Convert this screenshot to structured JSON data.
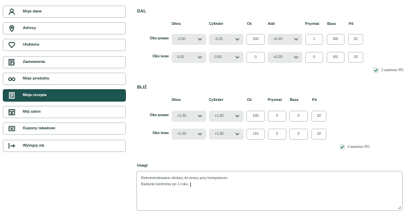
{
  "sidebar": {
    "items": [
      {
        "label": "Moje dane",
        "icon": "user-icon",
        "active": false
      },
      {
        "label": "Adresy",
        "icon": "location-pin-icon",
        "active": false
      },
      {
        "label": "Ulubione",
        "icon": "heart-icon",
        "active": false
      },
      {
        "label": "Zamówienia",
        "icon": "order-list-icon",
        "active": false
      },
      {
        "label": "Moje produkty",
        "icon": "glasses-icon",
        "active": false
      },
      {
        "label": "Moja recepta",
        "icon": "prescription-icon",
        "active": true
      },
      {
        "label": "Mój salon",
        "icon": "store-icon",
        "active": false
      },
      {
        "label": "Kupony rabatowe",
        "icon": "coupon-icon",
        "active": false
      },
      {
        "label": "Wyloguj się",
        "icon": "logout-icon",
        "active": false
      }
    ]
  },
  "dal": {
    "title": "DAL",
    "headers": {
      "sfera": "Sfera",
      "cylinder": "Cylinder",
      "os": "Oś",
      "add": "Add",
      "pryzmat": "Pryzmat",
      "baza": "Baza",
      "pd": "Pd"
    },
    "rows": [
      {
        "label": "Oko prawe",
        "sfera": "-2.50",
        "cylinder": "-0.25",
        "os": "180",
        "add": "+0.25",
        "pryzmat": "1",
        "baza": "BN",
        "pd": "32"
      },
      {
        "label": "Oko lewe",
        "sfera": "0.00",
        "cylinder": "0.00",
        "os": "0",
        "add": "+0.25",
        "pryzmat": "0",
        "baza": "BS",
        "pd": "33"
      }
    ],
    "pd_toggle": {
      "label": "2 wartości PD",
      "checked": true
    }
  },
  "bliz": {
    "title": "BLIŻ",
    "headers": {
      "sfera": "Sfera",
      "cylinder": "Cylinder",
      "os": "Oś",
      "pryzmat": "Pryzmat",
      "baza": "Baza",
      "pd": "Pd"
    },
    "rows": [
      {
        "label": "Oko prawe",
        "sfera": "+1.25",
        "cylinder": "+1.00",
        "os": "180",
        "pryzmat": "0",
        "baza": "0",
        "pd": "32"
      },
      {
        "label": "Oko lewe",
        "sfera": "+1.00",
        "cylinder": "+1.00",
        "os": "110",
        "pryzmat": "0",
        "baza": "0",
        "pd": "32"
      }
    ],
    "pd_toggle": {
      "label": "2 wartości PD",
      "checked": true
    }
  },
  "notes": {
    "label": "Uwagi",
    "line1": "Rekomendowane okulary do pracy przy komputerze.",
    "line2": "Badanie kontrolne po 1 roku."
  },
  "colors": {
    "accent": "#1e5450",
    "field_bg": "#e6e9e8",
    "border": "#c9d2d0"
  }
}
